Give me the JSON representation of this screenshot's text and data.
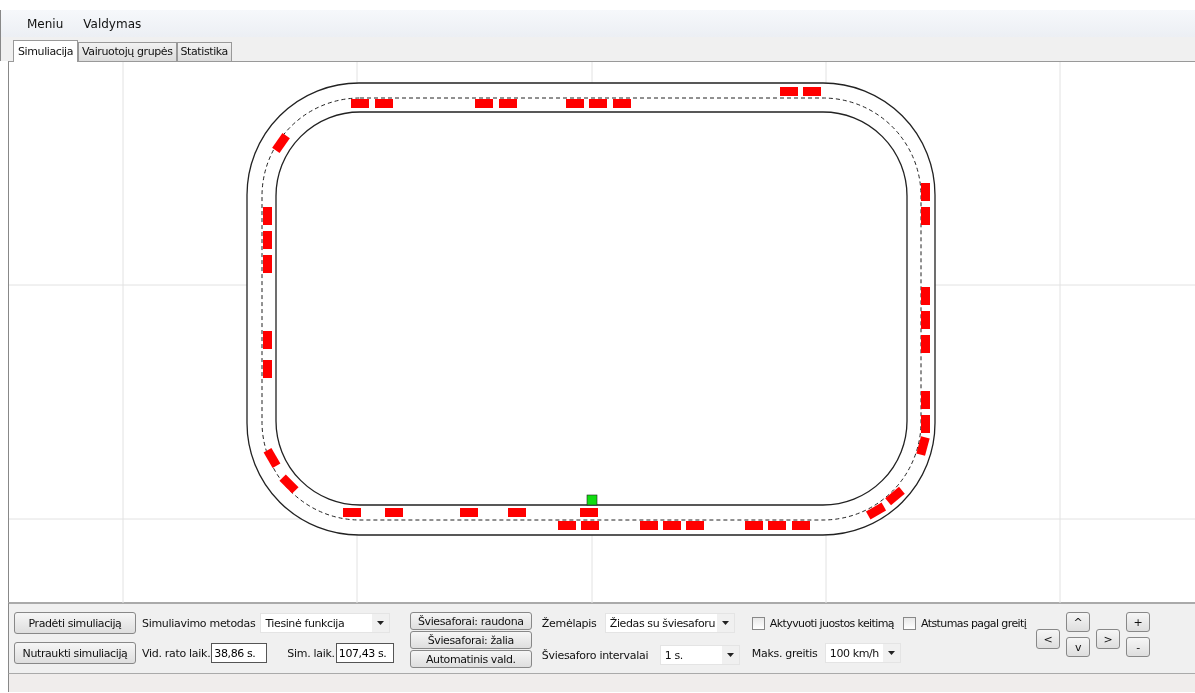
{
  "menu": [
    "Meniu",
    "Valdymas"
  ],
  "tabs": [
    {
      "label": "Simuliacija",
      "selected": true
    },
    {
      "label": "Vairuotojų grupės",
      "selected": false
    },
    {
      "label": "Statistika",
      "selected": false
    }
  ],
  "controls": {
    "start_button": "Pradėti simuliaciją",
    "stop_button": "Nutraukti simuliaciją",
    "method": {
      "label": "Simuliavimo metodas",
      "value": "Tiesinė funkcija"
    },
    "avg_lap": {
      "label": "Vid. rato laik.",
      "value": "38,86 s."
    },
    "sim_time": {
      "label": "Sim. laik.",
      "value": "107,43 s."
    },
    "light_buttons": [
      "Šviesaforai: raudona",
      "Šviesaforai: žalia",
      "Automatinis vald."
    ],
    "map": {
      "label": "Žemėlapis",
      "value": "Žiedas su šviesaforu"
    },
    "light_interval": {
      "label": "Šviesaforo intervalai",
      "value": "1 s."
    },
    "checkboxes": [
      {
        "label": "Aktyvuoti juostos keitimą",
        "checked": false
      },
      {
        "label": "Atstumas pagal greitį",
        "checked": false
      }
    ],
    "max_speed": {
      "label": "Maks. greitis",
      "value": "100 km/h"
    },
    "nav": {
      "up": "^",
      "left": "<",
      "right": ">",
      "down": "v",
      "plus": "+",
      "minus": "-"
    }
  }
}
